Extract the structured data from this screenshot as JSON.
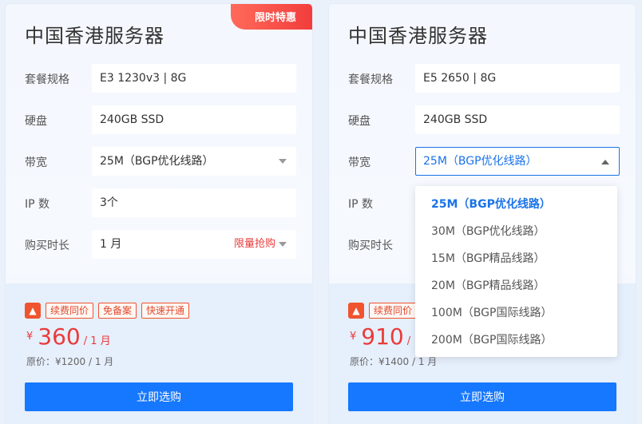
{
  "cards": [
    {
      "title": "中国香港服务器",
      "badge": "限时特惠",
      "spec_label": "套餐规格",
      "spec_value": "E3 1230v3 | 8G",
      "disk_label": "硬盘",
      "disk_value": "240GB SSD",
      "bw_label": "带宽",
      "bw_value": "25M（BGP优化线路）",
      "ip_label": "IP 数",
      "ip_value": "3个",
      "term_label": "购买时长",
      "term_value": "1 月",
      "term_note": "限量抢购",
      "tags": [
        "续费同价",
        "免备案",
        "快速开通"
      ],
      "currency": "¥",
      "price": "360",
      "price_unit": "/ 1 月",
      "original": "原价：¥1200 / 1 月",
      "buy": "立即选购"
    },
    {
      "title": "中国香港服务器",
      "spec_label": "套餐规格",
      "spec_value": "E5 2650 | 8G",
      "disk_label": "硬盘",
      "disk_value": "240GB SSD",
      "bw_label": "带宽",
      "bw_value": "25M（BGP优化线路）",
      "ip_label": "IP 数",
      "term_label": "购买时长",
      "tags": [
        "续费同价"
      ],
      "currency": "¥",
      "price": "910",
      "price_unit": "/",
      "original": "原价：¥1400 / 1 月",
      "buy": "立即选购"
    }
  ],
  "dropdown": {
    "options": [
      "25M（BGP优化线路）",
      "30M（BGP优化线路）",
      "15M（BGP精品线路）",
      "20M（BGP精品线路）",
      "100M（BGP国际线路）",
      "200M（BGP国际线路）"
    ],
    "selected_index": 0
  },
  "colors": {
    "accent": "#1677ff",
    "price": "#e93b3b",
    "badge": "#f23c3c"
  }
}
